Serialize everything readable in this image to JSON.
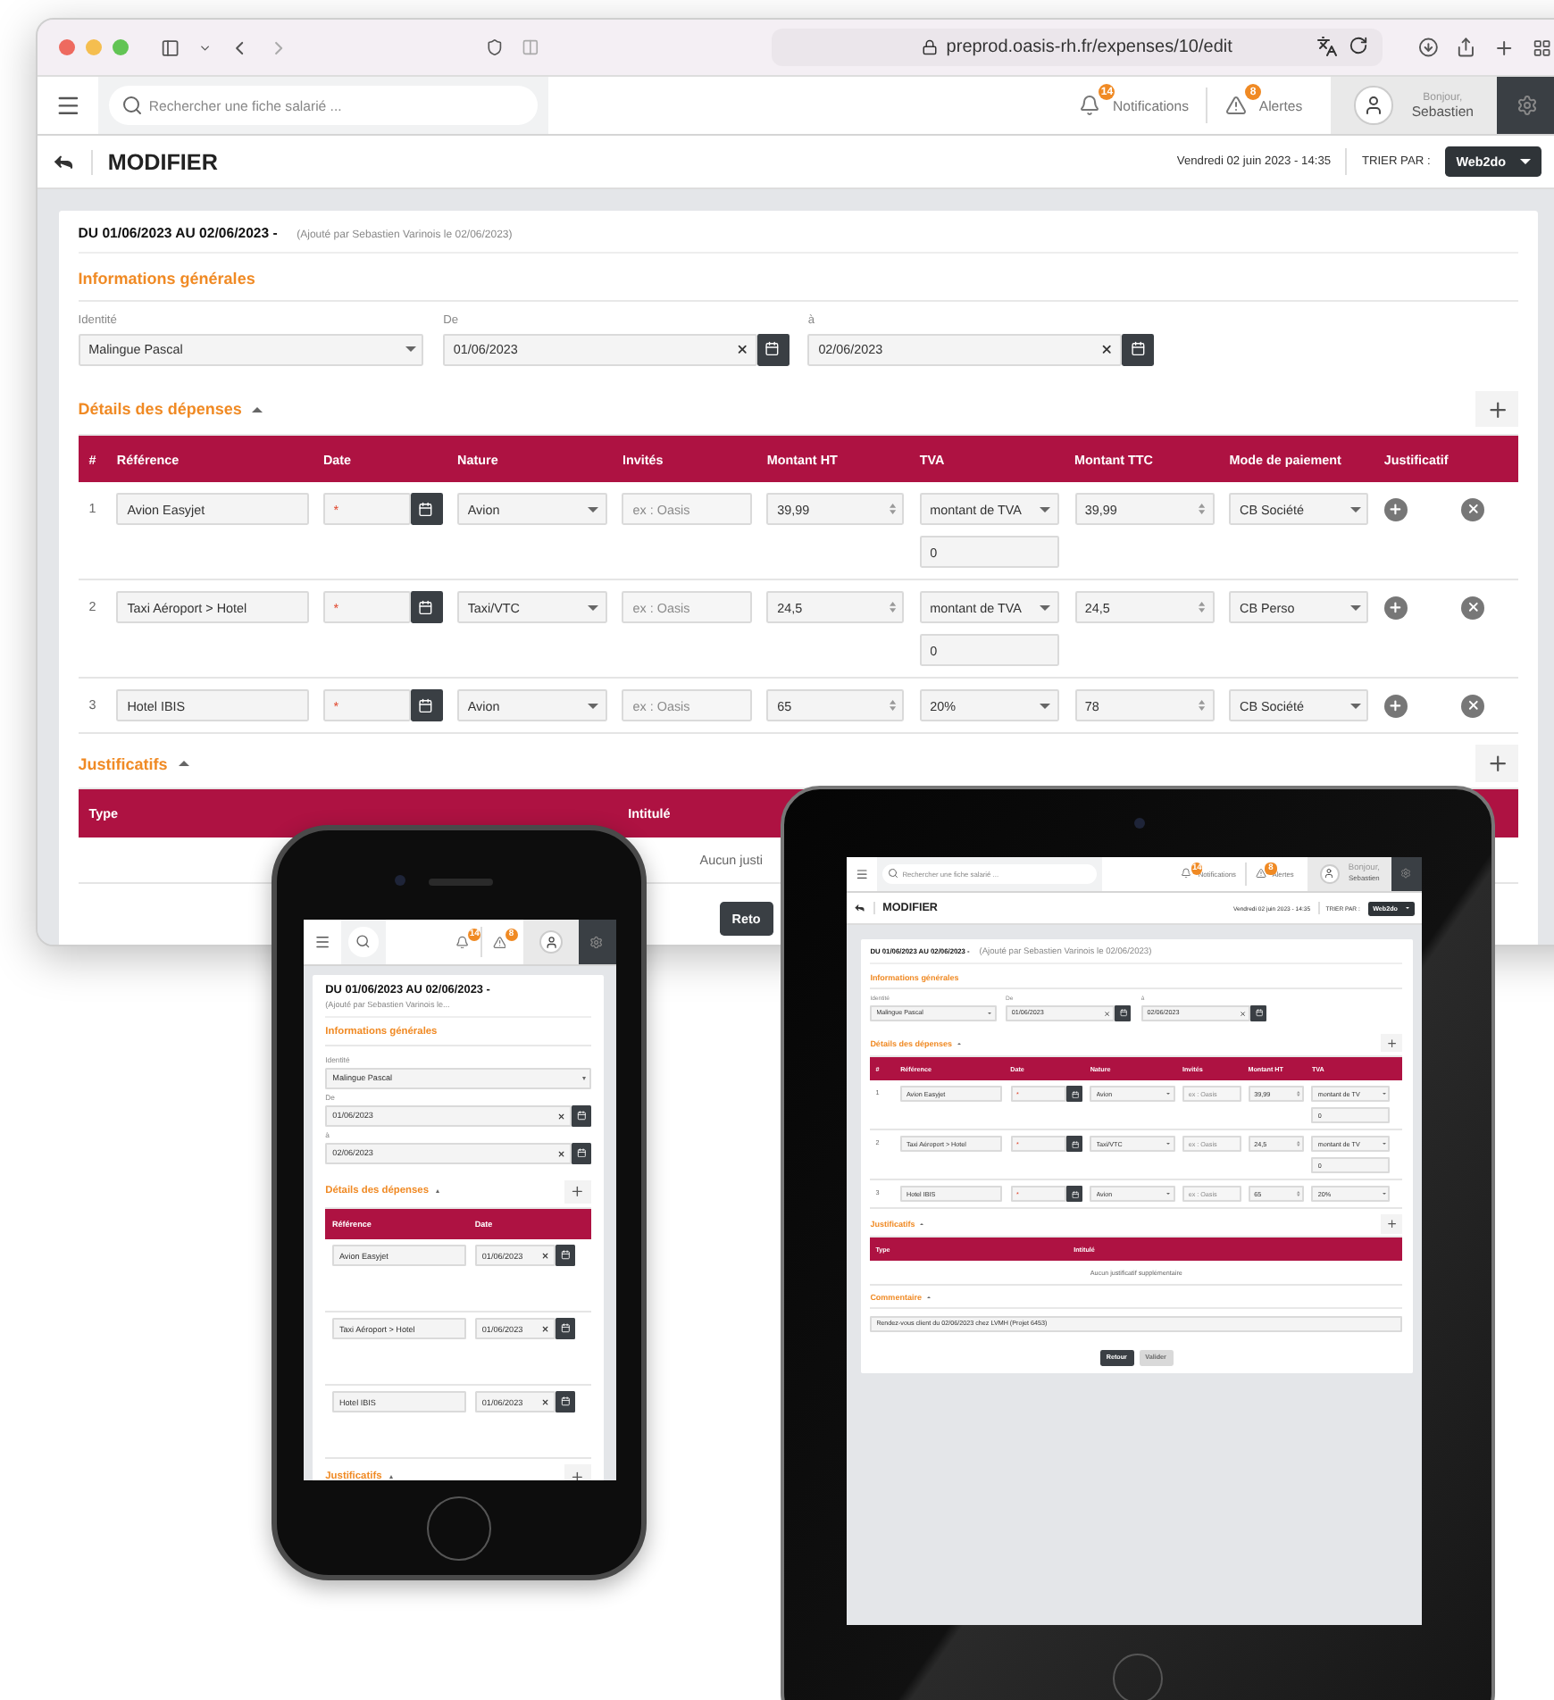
{
  "browser": {
    "url": "preprod.oasis-rh.fr/expenses/10/edit"
  },
  "desktop": {
    "header": {
      "search_placeholder": "Rechercher une fiche salarié ...",
      "notifications": {
        "label": "Notifications",
        "count": "14"
      },
      "alerts": {
        "label": "Alertes",
        "count": "8"
      },
      "greeting": "Bonjour,",
      "user": "Sebastien"
    },
    "toolbar": {
      "title": "MODIFIER",
      "datetime": "Vendredi 02 juin 2023 - 14:35",
      "sort_label": "TRIER PAR :",
      "sort_value": "Web2do"
    },
    "period": {
      "title": "DU 01/06/2023 AU 02/06/2023 -",
      "note": "(Ajouté par Sebastien Varinois le 02/06/2023)"
    },
    "general": {
      "title": "Informations générales",
      "fields": [
        {
          "label": "Identité",
          "kind": "select",
          "value": "Malingue Pascal"
        },
        {
          "label": "De",
          "kind": "date",
          "value": "01/06/2023"
        },
        {
          "label": "à",
          "kind": "date",
          "value": "02/06/2023"
        }
      ]
    },
    "expenses": {
      "title": "Détails des dépenses",
      "expanded": true,
      "can_add": true,
      "columns": [
        "#",
        "Référence",
        "Date",
        "Nature",
        "Invités",
        "Montant HT",
        "TVA",
        "Montant TTC",
        "Mode de paiement",
        "Justificatif"
      ],
      "rows": [
        {
          "cells": [
            {
              "kind": "index",
              "value": "1"
            },
            {
              "kind": "text",
              "value": "Avion Easyjet"
            },
            {
              "kind": "date",
              "placeholder": "*"
            },
            {
              "kind": "select",
              "value": "Avion"
            },
            {
              "kind": "placeholder",
              "placeholder": "ex : Oasis"
            },
            {
              "kind": "number",
              "value": "39,99"
            },
            {
              "kind": "select",
              "value": "montant de TVA",
              "sub": "0"
            },
            {
              "kind": "number",
              "value": "39,99"
            },
            {
              "kind": "select",
              "value": "CB Société"
            },
            {
              "kind": "add"
            },
            {
              "kind": "remove"
            }
          ]
        },
        {
          "cells": [
            {
              "kind": "index",
              "value": "2"
            },
            {
              "kind": "text",
              "value": "Taxi Aéroport > Hotel"
            },
            {
              "kind": "date",
              "placeholder": "*"
            },
            {
              "kind": "select",
              "value": "Taxi/VTC"
            },
            {
              "kind": "placeholder",
              "placeholder": "ex : Oasis"
            },
            {
              "kind": "number",
              "value": "24,5"
            },
            {
              "kind": "select",
              "value": "montant de TVA",
              "sub": "0"
            },
            {
              "kind": "number",
              "value": "24,5"
            },
            {
              "kind": "select",
              "value": "CB Perso"
            },
            {
              "kind": "add"
            },
            {
              "kind": "remove"
            }
          ]
        },
        {
          "cells": [
            {
              "kind": "index",
              "value": "3"
            },
            {
              "kind": "text",
              "value": "Hotel IBIS"
            },
            {
              "kind": "date",
              "placeholder": "*"
            },
            {
              "kind": "select",
              "value": "Avion"
            },
            {
              "kind": "placeholder",
              "placeholder": "ex : Oasis"
            },
            {
              "kind": "number",
              "value": "65"
            },
            {
              "kind": "select",
              "value": "20%"
            },
            {
              "kind": "number",
              "value": "78"
            },
            {
              "kind": "select",
              "value": "CB Société"
            },
            {
              "kind": "add"
            },
            {
              "kind": "remove"
            }
          ]
        }
      ]
    },
    "receipts": {
      "title": "Justificatifs",
      "expanded": true,
      "can_add": true,
      "columns": [
        "Type",
        "Intitulé"
      ],
      "empty": "Aucun justi"
    },
    "buttons": [
      {
        "label": "Reto",
        "disabled": false
      }
    ]
  },
  "tablet": {
    "header": {
      "search_placeholder": "Rechercher une fiche salarié ...",
      "notifications": {
        "label": "Notifications",
        "count": "14"
      },
      "alerts": {
        "label": "Alertes",
        "count": "8"
      },
      "greeting": "Bonjour,",
      "user": "Sebastien"
    },
    "toolbar": {
      "title": "MODIFIER",
      "datetime": "Vendredi 02 juin 2023 - 14:35",
      "sort_label": "TRIER PAR :",
      "sort_value": "Web2do"
    },
    "period": {
      "title": "DU 01/06/2023 AU 02/06/2023 -",
      "note": "(Ajouté par Sebastien Varinois le 02/06/2023)"
    },
    "general": {
      "title": "Informations générales",
      "fields": [
        {
          "label": "Identité",
          "kind": "select",
          "value": "Malingue Pascal"
        },
        {
          "label": "De",
          "kind": "date",
          "value": "01/06/2023"
        },
        {
          "label": "à",
          "kind": "date",
          "value": "02/06/2023"
        }
      ]
    },
    "expenses": {
      "title": "Détails des dépenses",
      "expanded": true,
      "can_add": true,
      "columns": [
        "#",
        "Référence",
        "Date",
        "Nature",
        "Invités",
        "Montant HT",
        "TVA"
      ],
      "rows": [
        {
          "cells": [
            {
              "kind": "index",
              "value": "1"
            },
            {
              "kind": "text",
              "value": "Avion Easyjet"
            },
            {
              "kind": "date",
              "placeholder": "*"
            },
            {
              "kind": "select",
              "value": "Avion"
            },
            {
              "kind": "placeholder",
              "placeholder": "ex : Oasis"
            },
            {
              "kind": "number",
              "value": "39,99"
            },
            {
              "kind": "select",
              "value": "montant de TV",
              "sub": "0"
            }
          ]
        },
        {
          "cells": [
            {
              "kind": "index",
              "value": "2"
            },
            {
              "kind": "text",
              "value": "Taxi Aéroport > Hotel"
            },
            {
              "kind": "date",
              "placeholder": "*"
            },
            {
              "kind": "select",
              "value": "Taxi/VTC"
            },
            {
              "kind": "placeholder",
              "placeholder": "ex : Oasis"
            },
            {
              "kind": "number",
              "value": "24,5"
            },
            {
              "kind": "select",
              "value": "montant de TV",
              "sub": "0"
            }
          ]
        },
        {
          "cells": [
            {
              "kind": "index",
              "value": "3"
            },
            {
              "kind": "text",
              "value": "Hotel IBIS"
            },
            {
              "kind": "date",
              "placeholder": "*"
            },
            {
              "kind": "select",
              "value": "Avion"
            },
            {
              "kind": "placeholder",
              "placeholder": "ex : Oasis"
            },
            {
              "kind": "number",
              "value": "65"
            },
            {
              "kind": "select",
              "value": "20%"
            }
          ]
        }
      ]
    },
    "receipts": {
      "title": "Justificatifs",
      "expanded": true,
      "can_add": true,
      "columns": [
        "Type",
        "Intitulé"
      ],
      "empty": "Aucun justificatif supplémentaire"
    },
    "comment": {
      "title": "Commentaire",
      "expanded": true,
      "value": "Rendez-vous client du 02/06/2023 chez LVMH (Projet 6453)"
    },
    "buttons": [
      {
        "label": "Retour",
        "disabled": false
      },
      {
        "label": "Valider",
        "disabled": true
      }
    ]
  },
  "phone": {
    "header": {
      "notifications": {
        "count": "14"
      },
      "alerts": {
        "count": "8"
      }
    },
    "period": {
      "title": "DU 01/06/2023 AU 02/06/2023 -",
      "note": "(Ajouté par Sebastien Varinois le..."
    },
    "general": {
      "title": "Informations générales",
      "fields": [
        {
          "label": "Identité",
          "kind": "select",
          "value": "Malingue Pascal"
        },
        {
          "label": "De",
          "kind": "date",
          "value": "01/06/2023"
        },
        {
          "label": "à",
          "kind": "date",
          "value": "02/06/2023"
        }
      ]
    },
    "expenses": {
      "title": "Détails des dépenses",
      "expanded": true,
      "can_add": true,
      "columns": [
        "Référence",
        "Date"
      ],
      "rows": [
        {
          "cells": [
            {
              "kind": "text",
              "value": "Avion Easyjet"
            },
            {
              "kind": "date",
              "value": "01/06/2023"
            }
          ]
        },
        {
          "cells": [
            {
              "kind": "text",
              "value": "Taxi Aéroport > Hotel"
            },
            {
              "kind": "date",
              "value": "01/06/2023"
            }
          ]
        },
        {
          "cells": [
            {
              "kind": "text",
              "value": "Hotel IBIS"
            },
            {
              "kind": "date",
              "value": "01/06/2023"
            }
          ]
        }
      ]
    },
    "receipts": {
      "title": "Justificatifs",
      "expanded": true,
      "can_add": true
    }
  }
}
